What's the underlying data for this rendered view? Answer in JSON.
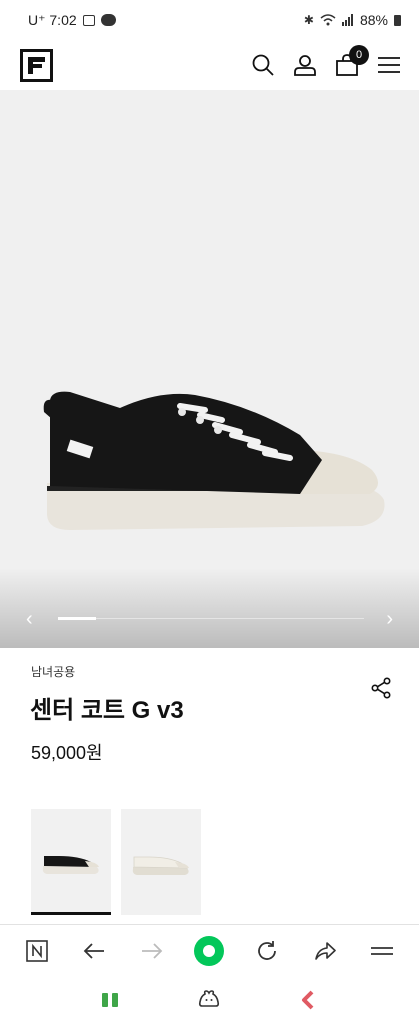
{
  "status_bar": {
    "carrier_time": "U⁺ 7:02",
    "battery": "88%",
    "icons": [
      "gallery-icon",
      "talk-icon",
      "bluetooth-icon",
      "wifi-icon",
      "signal-icon",
      "battery-icon"
    ]
  },
  "header": {
    "logo_icon": "fila-logo-icon",
    "cart_count": "0",
    "icons": [
      "search-icon",
      "user-icon",
      "cart-icon",
      "menu-icon"
    ]
  },
  "hero": {
    "slide_progress": 0.125,
    "prev_label": "‹",
    "next_label": "›"
  },
  "product": {
    "gender": "남녀공용",
    "name": "센터 코트 G v3",
    "price": "59,000원"
  },
  "thumbnails": [
    {
      "color_name": "black",
      "selected": true
    },
    {
      "color_name": "white",
      "selected": false
    }
  ],
  "browser_toolbar": {
    "icons": [
      "naver-n-icon",
      "back-arrow-icon",
      "forward-arrow-icon",
      "green-home-icon",
      "refresh-icon",
      "share-arrow-icon",
      "menu-icon"
    ]
  },
  "android_nav": {
    "icons": [
      "recent-apps-icon",
      "home-icon",
      "back-icon"
    ]
  },
  "colors": {
    "accent_green": "#03c75a",
    "text": "#111111",
    "hero_bg": "#f0f0f0"
  }
}
